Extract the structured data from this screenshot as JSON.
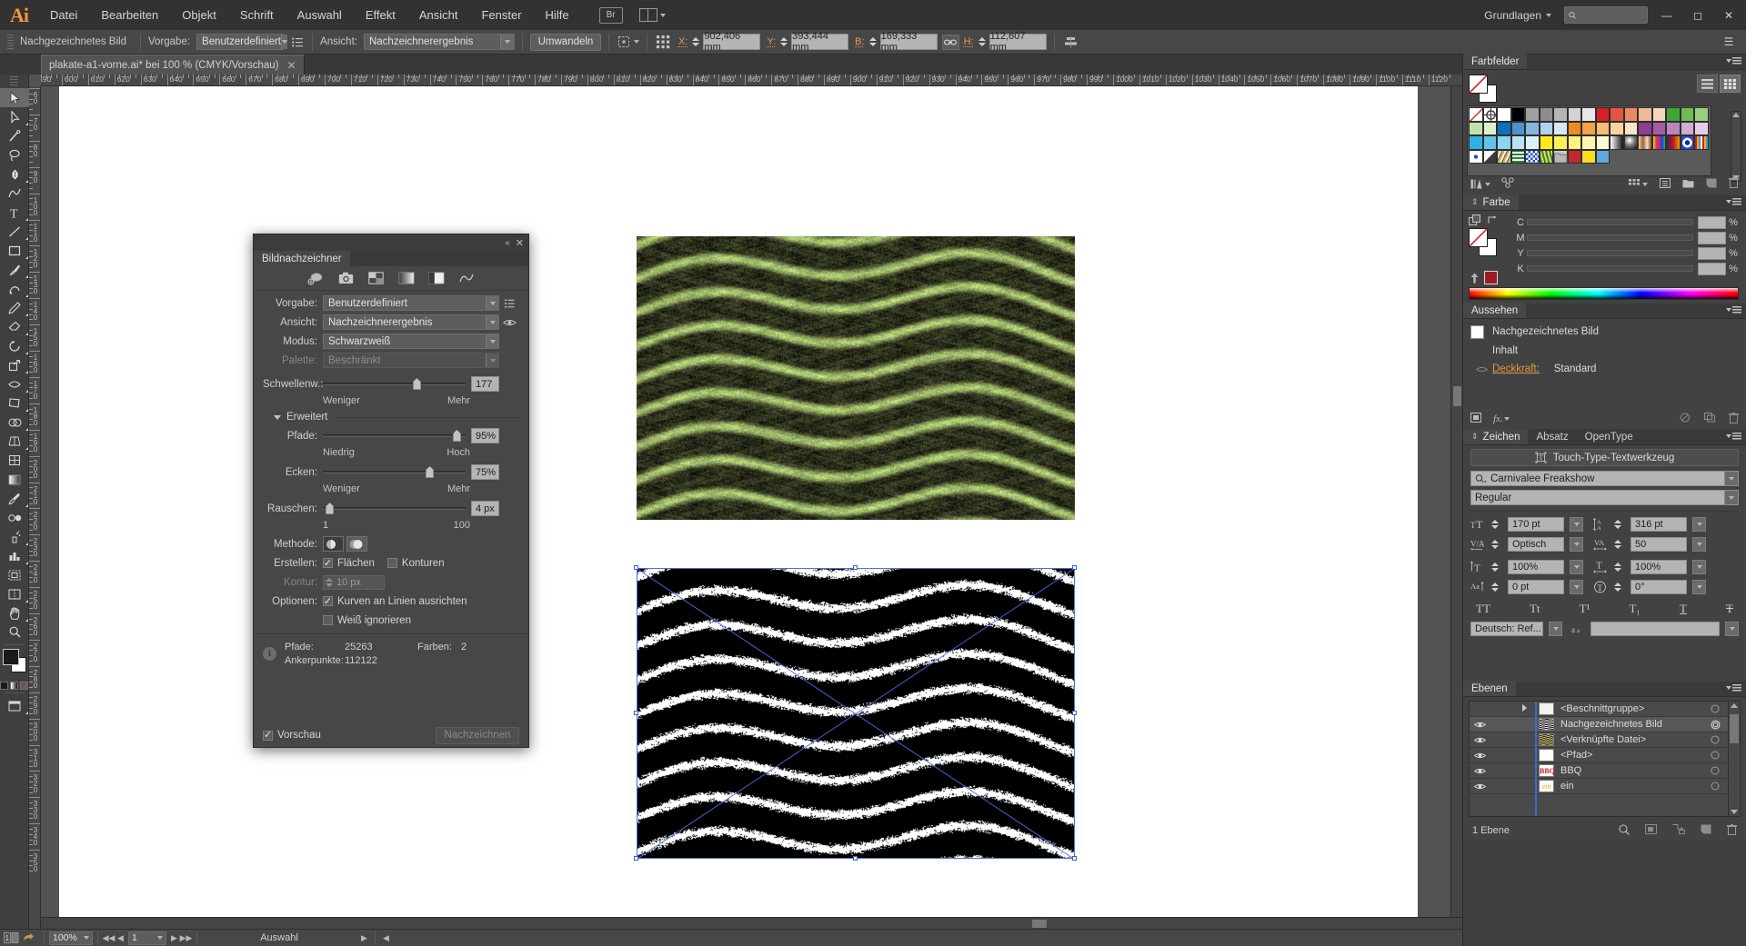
{
  "app": {
    "name": "Ai",
    "workspace": "Grundlagen",
    "search_placeholder": ""
  },
  "menubar": {
    "items": [
      "Datei",
      "Bearbeiten",
      "Objekt",
      "Schrift",
      "Auswahl",
      "Effekt",
      "Ansicht",
      "Fenster",
      "Hilfe"
    ],
    "bridge_label": "Br"
  },
  "controlbar": {
    "object_type": "Nachgezeichnetes Bild",
    "preset_label": "Vorgabe:",
    "preset_value": "Benutzerdefiniert",
    "view_label": "Ansicht:",
    "view_value": "Nachzeichnerergebnis",
    "expand_button": "Umwandeln",
    "x_label": "X:",
    "x_value": "902,406 mm",
    "y_label": "Y:",
    "y_value": "393,444 mm",
    "w_label": "B:",
    "w_value": "169,333 mm",
    "h_label": "H:",
    "h_value": "112,607 mm"
  },
  "document": {
    "tab_title": "plakate-a1-vorne.ai* bei 100 % (CMYK/Vorschau)"
  },
  "ruler": {
    "h_labels": [
      "590",
      "600",
      "610",
      "620",
      "630",
      "640",
      "650",
      "660",
      "670",
      "680",
      "690",
      "700",
      "710",
      "720",
      "730",
      "740",
      "750",
      "760",
      "770",
      "780",
      "790",
      "800",
      "810",
      "820",
      "830",
      "840",
      "850",
      "860",
      "870",
      "880",
      "890",
      "900",
      "910",
      "920",
      "930",
      "940",
      "950",
      "960",
      "970",
      "980",
      "990",
      "1000",
      "1010",
      "1020",
      "1030",
      "1040",
      "1050",
      "1060",
      "1070",
      "1080",
      "1090",
      "1100",
      "1110",
      "1120"
    ],
    "v_labels": [
      "60",
      "70",
      "80",
      "90",
      "100",
      "110",
      "120",
      "130",
      "140",
      "150",
      "160",
      "170",
      "180",
      "190",
      "200",
      "210",
      "220",
      "230",
      "240",
      "250",
      "260",
      "270",
      "280",
      "290",
      "300",
      "310",
      "320",
      "330",
      "340",
      "350"
    ]
  },
  "trace_dialog": {
    "tab_title": "Bildnachzeichner",
    "preset_label": "Vorgabe:",
    "preset_value": "Benutzerdefiniert",
    "view_label": "Ansicht:",
    "view_value": "Nachzeichnerergebnis",
    "mode_label": "Modus:",
    "mode_value": "Schwarzweiß",
    "palette_label": "Palette:",
    "palette_value": "Beschränkt",
    "threshold_label": "Schwellenw.:",
    "threshold_value": "177",
    "threshold_min": "Weniger",
    "threshold_max": "Mehr",
    "advanced_label": "Erweitert",
    "paths_label": "Pfade:",
    "paths_value": "95%",
    "paths_min": "Niedrig",
    "paths_max": "Hoch",
    "corners_label": "Ecken:",
    "corners_value": "75%",
    "corners_min": "Weniger",
    "corners_max": "Mehr",
    "noise_label": "Rauschen:",
    "noise_value": "4 px",
    "noise_min": "1",
    "noise_max": "100",
    "method_label": "Methode:",
    "create_label": "Erstellen:",
    "create_fills": "Flächen",
    "create_strokes": "Konturen",
    "stroke_label": "Kontur:",
    "stroke_value": "10 px",
    "options_label": "Optionen:",
    "option_snap_curves": "Kurven an Linien ausrichten",
    "option_ignore_white": "Weiß ignorieren",
    "info_paths_label": "Pfade:",
    "info_paths_value": "25263",
    "info_colors_label": "Farben:",
    "info_colors_value": "2",
    "info_anchors_label": "Ankerpunkte:",
    "info_anchors_value": "112122",
    "preview_label": "Vorschau",
    "trace_button": "Nachzeichnen"
  },
  "swatches_panel": {
    "title": "Farbfelder",
    "colors": [
      "none",
      "registration",
      "#ffffff",
      "#000000",
      "#a0a0a0",
      "#8c8c8c",
      "#b5b5b5",
      "#d2d2d2",
      "#e8e8e8",
      "#d91f26",
      "#e3553f",
      "#e98a63",
      "#f2b896",
      "#f7d5be",
      "#3fa535",
      "#6fbb55",
      "#9bcf7f",
      "#c3e2ab",
      "#dcf0cc",
      "#0f6fb8",
      "#4a93cc",
      "#83b5dd",
      "#b3d0eb",
      "#d6e6f5",
      "#ef8b22",
      "#f2a248",
      "#f5bb77",
      "#f8d2a3",
      "#fae5c9",
      "#8e3d8f",
      "#a35ca4",
      "#bb85bb",
      "#d2aad2",
      "#e6cde6",
      "#2eb0e5",
      "#5fc3ea",
      "#8dd4f0",
      "#b8e4f5",
      "#dbf1fa",
      "#fdea1a",
      "#fdef56",
      "#fef284",
      "#fef6b0",
      "#fefad3",
      "gradient-bw",
      "gradient-sphere",
      "gradient-copper",
      "gradient-rainbow",
      "gradient-stripe",
      "pattern-dot",
      "pattern-rainbow",
      "pattern-flower",
      "pattern-bw",
      "pattern-leaf",
      "pattern-green",
      "pattern-blue",
      "pattern-grass",
      "folder",
      "#c0282d",
      "#fbdc1e",
      "#5fa8d8"
    ]
  },
  "color_panel": {
    "title": "Farbe",
    "channels": [
      {
        "label": "C",
        "value": "",
        "unit": "%"
      },
      {
        "label": "M",
        "value": "",
        "unit": "%"
      },
      {
        "label": "Y",
        "value": "",
        "unit": "%"
      },
      {
        "label": "K",
        "value": "",
        "unit": "%"
      }
    ],
    "accent_swatch": "#9b1b24"
  },
  "appearance_panel": {
    "title": "Aussehen",
    "object_name": "Nachgezeichnetes Bild",
    "content_label": "Inhalt",
    "opacity_label": "Deckkraft:",
    "opacity_value": "Standard",
    "opacity_color": "#e09a42"
  },
  "character_panel": {
    "tabs": [
      "Zeichen",
      "Absatz",
      "OpenType"
    ],
    "active_tab": "Zeichen",
    "touch_type_button": "Touch-Type-Textwerkzeug",
    "font_family": "Carnivalee Freakshow",
    "font_style": "Regular",
    "font_size": "170 pt",
    "leading": "316 pt",
    "kerning": "Optisch",
    "tracking": "50",
    "vertical_scale": "100%",
    "horizontal_scale": "100%",
    "baseline_shift": "0 pt",
    "rotation": "0°",
    "language": "Deutsch: Ref...",
    "anti_alias": "",
    "style_buttons": [
      "TT",
      "Tt",
      "T¹",
      "T₁",
      "T",
      "T"
    ]
  },
  "layers_panel": {
    "title": "Ebenen",
    "rows": [
      {
        "name": "<Beschnittgruppe>",
        "visible": false,
        "expandable": true,
        "selected": false,
        "thumb": "#f2f2f2"
      },
      {
        "name": "Nachgezeichnetes Bild",
        "visible": true,
        "expandable": false,
        "selected": true,
        "thumb": "#d8d8d8"
      },
      {
        "name": "<Verknüpfte Datei>",
        "visible": true,
        "expandable": false,
        "selected": false,
        "thumb": "#6b6a3a"
      },
      {
        "name": "<Pfad>",
        "visible": true,
        "expandable": false,
        "selected": false,
        "thumb": "#ffffff"
      },
      {
        "name": "BBQ",
        "visible": true,
        "expandable": false,
        "selected": false,
        "thumb": "#ffffff"
      },
      {
        "name": "ein",
        "visible": true,
        "expandable": false,
        "selected": false,
        "thumb": "#ffffff"
      }
    ],
    "footer_count": "1 Ebene"
  },
  "statusbar": {
    "zoom": "100%",
    "page": "1",
    "status_text": "Auswahl"
  },
  "icons": {
    "search": "search-icon",
    "gear": "gear-icon",
    "camera": "camera-icon",
    "eye": "eye-icon",
    "lock": "lock-icon",
    "trash": "trash-icon",
    "folder": "folder-icon",
    "link": "link-icon"
  }
}
